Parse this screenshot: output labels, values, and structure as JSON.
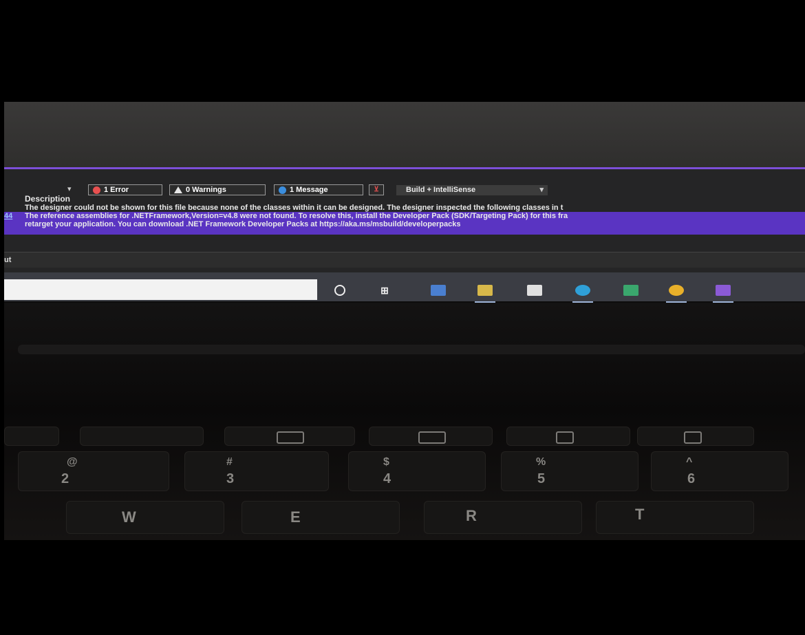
{
  "toolbar": {
    "errors_label": "1 Error",
    "warnings_label": "0 Warnings",
    "messages_label": "1 Message",
    "filter_label": "Build + IntelliSense"
  },
  "error_list": {
    "column_header": "Description",
    "rows": [
      "The designer could not be shown for this file because none of the classes within it can be designed.  The designer inspected the following classes in t",
      "The reference assemblies for .NETFramework,Version=v4.8 were not found. To resolve this, install the Developer Pack (SDK/Targeting Pack) for this fra",
      "retarget your application. You can download .NET Framework Developer Packs at https://aka.ms/msbuild/developerpacks"
    ],
    "row_code_fragment": "44"
  },
  "output_tab_label": "ut",
  "taskbar_icons": [
    "cortana-icon",
    "task-view-icon",
    "app-icon",
    "file-explorer-icon",
    "store-icon",
    "edge-icon",
    "app-icon",
    "chrome-icon",
    "visual-studio-icon"
  ],
  "keyboard": {
    "number_row": [
      {
        "sym": "@",
        "digit": "2"
      },
      {
        "sym": "#",
        "digit": "3"
      },
      {
        "sym": "$",
        "digit": "4"
      },
      {
        "sym": "%",
        "digit": "5"
      },
      {
        "sym": "^",
        "digit": "6"
      }
    ],
    "letter_row": [
      "W",
      "E",
      "R",
      "T"
    ]
  },
  "colors": {
    "accent": "#7d4fd9",
    "selection": "#5a34c2",
    "error": "#e85050",
    "message": "#3b8ede"
  }
}
